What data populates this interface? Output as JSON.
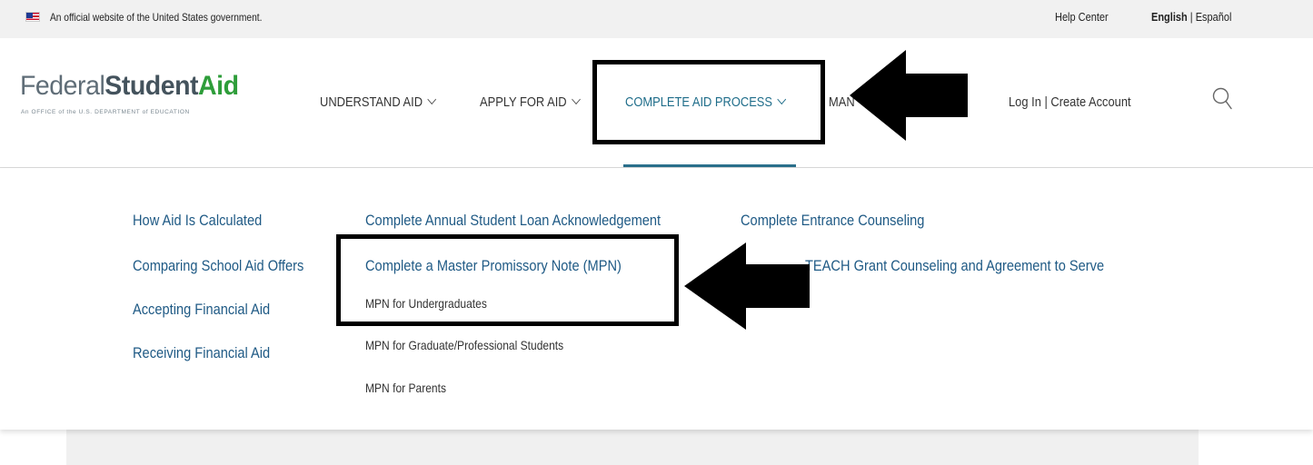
{
  "gov_banner": {
    "text": "An official website of the United States government.",
    "help_center": "Help Center",
    "lang_active": "English",
    "lang_sep": " | ",
    "lang_other": "Español"
  },
  "logo": {
    "word1": "Federal",
    "word2": "Student",
    "word3": "Aid",
    "tagline": "An OFFICE of the U.S. DEPARTMENT of EDUCATION"
  },
  "nav": {
    "items": [
      {
        "label": "UNDERSTAND AID"
      },
      {
        "label": "APPLY FOR AID"
      },
      {
        "label": "COMPLETE AID PROCESS"
      },
      {
        "label": "MAN"
      }
    ],
    "login": "Log In",
    "login_sep": " | ",
    "create_account": "Create Account"
  },
  "mega_menu": {
    "col1": [
      {
        "label": "How Aid Is Calculated"
      },
      {
        "label": "Comparing School Aid Offers"
      },
      {
        "label": "Accepting Financial Aid"
      },
      {
        "label": "Receiving Financial Aid"
      }
    ],
    "col2": [
      {
        "label": "Complete Annual Student Loan Acknowledgement"
      },
      {
        "label": "Complete a Master Promissory Note (MPN)"
      }
    ],
    "col2_sub": [
      {
        "label": "MPN for Undergraduates"
      },
      {
        "label": "MPN for Graduate/Professional Students"
      },
      {
        "label": "MPN for Parents"
      }
    ],
    "col3": [
      {
        "label": "Complete Entrance Counseling"
      },
      {
        "label": "TEACH Grant Counseling and Agreement to Serve"
      }
    ]
  },
  "colors": {
    "link_blue": "#1f5a85",
    "active_teal": "#1f6d8a",
    "logo_green": "#2e9d3a",
    "annotation": "#000000"
  }
}
